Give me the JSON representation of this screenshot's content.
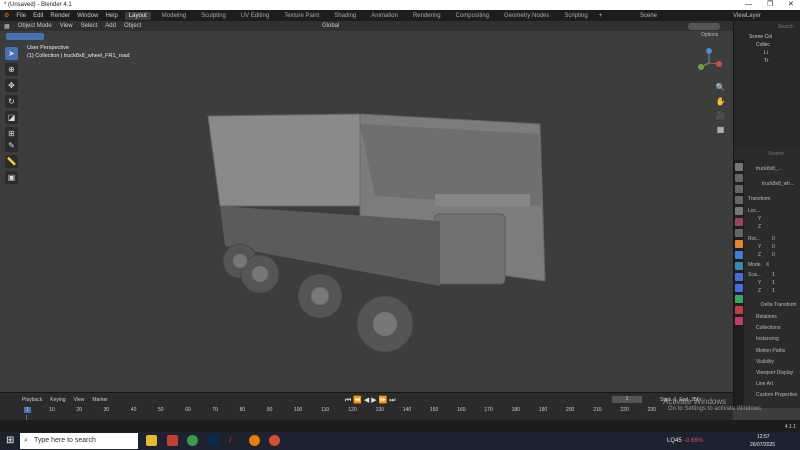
{
  "window": {
    "title": "* (Unsaved) - Blender 4.1"
  },
  "menu": [
    "File",
    "Edit",
    "Render",
    "Window",
    "Help"
  ],
  "workspaces": [
    "Layout",
    "Modeling",
    "Sculpting",
    "UV Editing",
    "Texture Paint",
    "Shading",
    "Animation",
    "Rendering",
    "Compositing",
    "Geometry Nodes",
    "Scripting"
  ],
  "active_workspace": "Layout",
  "scene": "Scene",
  "view_layer": "ViewLayer",
  "viewport_header": {
    "mode": "Object Mode",
    "items": [
      "View",
      "Select",
      "Add",
      "Object"
    ],
    "orientation": "Global",
    "options": "Options"
  },
  "overlay": {
    "line1": "User Perspective",
    "line2": "(1) Collection | truck8x8_wheel_FR1_road"
  },
  "outliner": {
    "search": "Search",
    "items": [
      "Scene Col",
      "Collec",
      "Li",
      "Tr"
    ]
  },
  "properties": {
    "search": "Search",
    "object": "truck8x8_...",
    "data": "truck8x8_wh...",
    "transform": "Transform",
    "loc": [
      "Loc...",
      "Y",
      "Z"
    ],
    "rot": [
      "Rot...",
      "Y",
      "Z"
    ],
    "rot_vals": [
      "0",
      "0",
      "0"
    ],
    "mode_label": "Mode",
    "mode": "X",
    "scale": [
      "Sca...",
      "Y",
      "Z"
    ],
    "scale_vals": [
      "1",
      "1",
      "1"
    ],
    "sections": [
      "Delta Transform",
      "Relations",
      "Collections",
      "Instancing",
      "Motion Paths",
      "Visibility",
      "Viewport Display",
      "Line Art",
      "Custom Properties"
    ]
  },
  "timeline": {
    "menus": [
      "Playback",
      "Keying",
      "View",
      "Marker"
    ],
    "current_frame": "1",
    "start_label": "Start",
    "start": "1",
    "end_label": "End",
    "end": "250",
    "ticks": [
      "1",
      "10",
      "20",
      "30",
      "40",
      "50",
      "60",
      "70",
      "80",
      "90",
      "100",
      "110",
      "120",
      "130",
      "140",
      "150",
      "160",
      "170",
      "180",
      "190",
      "200",
      "210",
      "220",
      "230"
    ]
  },
  "watermark": {
    "line1": "Activate Windows",
    "line2": "Go to Settings to activate Windows."
  },
  "version": "4.1.1",
  "taskbar": {
    "search_placeholder": "Type here to search",
    "stock": "LQ45",
    "stock_change": "-0.66%",
    "time": "12:57",
    "date": "26/07/2025"
  },
  "colors": {
    "accent": "#4772b3",
    "stock_red": "#e05050"
  }
}
